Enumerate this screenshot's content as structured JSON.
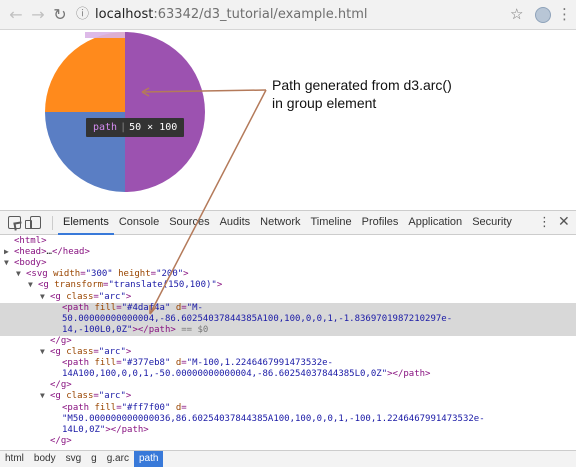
{
  "browser": {
    "url_host": "localhost",
    "url_rest": ":63342/d3_tutorial/example.html",
    "back_icon": "back-arrow-icon",
    "forward_icon": "forward-arrow-icon",
    "reload_icon": "reload-icon"
  },
  "page": {
    "annotation": "Path generated from d3.arc() in group element",
    "tooltip": {
      "tag": "path",
      "size": "50 × 100"
    },
    "pie_colors": [
      "#4daf4a",
      "#377eb8",
      "#ff7f00"
    ]
  },
  "chart_data": {
    "type": "pie",
    "values": [
      50,
      25,
      25
    ],
    "colors": [
      "#9c52b0",
      "#5a7ec4",
      "#ff8a1c"
    ],
    "highlight": "#d9b3e6"
  },
  "devtools": {
    "tabs": [
      "Elements",
      "Console",
      "Sources",
      "Audits",
      "Network",
      "Timeline",
      "Profiles",
      "Application",
      "Security"
    ],
    "active_tab": "Elements",
    "dom_lines": [
      {
        "indent": 0,
        "tw": "",
        "html": [
          [
            "t",
            "<html>"
          ]
        ]
      },
      {
        "indent": 0,
        "tw": "▶",
        "html": [
          [
            "t",
            "<head>"
          ],
          [
            "pl",
            "…"
          ],
          [
            "t",
            "</head>"
          ]
        ]
      },
      {
        "indent": 0,
        "tw": "▼",
        "html": [
          [
            "t",
            "<body>"
          ]
        ]
      },
      {
        "indent": 1,
        "tw": "▼",
        "html": [
          [
            "t",
            "<svg "
          ],
          [
            "an",
            "width"
          ],
          [
            "t",
            "="
          ],
          [
            "av",
            "\"300\""
          ],
          [
            "t",
            " "
          ],
          [
            "an",
            "height"
          ],
          [
            "t",
            "="
          ],
          [
            "av",
            "\"200\""
          ],
          [
            "t",
            ">"
          ]
        ]
      },
      {
        "indent": 2,
        "tw": "▼",
        "html": [
          [
            "t",
            "<g "
          ],
          [
            "an",
            "transform"
          ],
          [
            "t",
            "="
          ],
          [
            "av",
            "\"translate(150,100)\""
          ],
          [
            "t",
            ">"
          ]
        ]
      },
      {
        "indent": 3,
        "tw": "▼",
        "html": [
          [
            "t",
            "<g "
          ],
          [
            "an",
            "class"
          ],
          [
            "t",
            "="
          ],
          [
            "av",
            "\"arc\""
          ],
          [
            "t",
            ">"
          ]
        ]
      },
      {
        "indent": 4,
        "tw": "",
        "sel": true,
        "html": [
          [
            "t",
            "<path "
          ],
          [
            "an",
            "fill"
          ],
          [
            "t",
            "="
          ],
          [
            "av",
            "\"#4daf4a\""
          ],
          [
            "t",
            " "
          ],
          [
            "an",
            "d"
          ],
          [
            "t",
            "="
          ],
          [
            "av",
            "\"M-"
          ]
        ]
      },
      {
        "indent": 4,
        "tw": "",
        "sel": true,
        "html": [
          [
            "av",
            "50.00000000000004,-86.60254037844385A100,100,0,0,1,-1.8369701987210297e-"
          ]
        ]
      },
      {
        "indent": 4,
        "tw": "",
        "sel": true,
        "html": [
          [
            "av",
            "14,-100L0,0Z\""
          ],
          [
            "t",
            "></path>"
          ],
          [
            "eq",
            " == $0"
          ]
        ]
      },
      {
        "indent": 3,
        "tw": "",
        "html": [
          [
            "t",
            "</g>"
          ]
        ]
      },
      {
        "indent": 3,
        "tw": "▼",
        "html": [
          [
            "t",
            "<g "
          ],
          [
            "an",
            "class"
          ],
          [
            "t",
            "="
          ],
          [
            "av",
            "\"arc\""
          ],
          [
            "t",
            ">"
          ]
        ]
      },
      {
        "indent": 4,
        "tw": "",
        "html": [
          [
            "t",
            "<path "
          ],
          [
            "an",
            "fill"
          ],
          [
            "t",
            "="
          ],
          [
            "av",
            "\"#377eb8\""
          ],
          [
            "t",
            " "
          ],
          [
            "an",
            "d"
          ],
          [
            "t",
            "="
          ],
          [
            "av",
            "\"M-100,1.2246467991473532e-"
          ]
        ]
      },
      {
        "indent": 4,
        "tw": "",
        "html": [
          [
            "av",
            "14A100,100,0,0,1,-50.00000000000004,-86.60254037844385L0,0Z\""
          ],
          [
            "t",
            "></path>"
          ]
        ]
      },
      {
        "indent": 3,
        "tw": "",
        "html": [
          [
            "t",
            "</g>"
          ]
        ]
      },
      {
        "indent": 3,
        "tw": "▼",
        "html": [
          [
            "t",
            "<g "
          ],
          [
            "an",
            "class"
          ],
          [
            "t",
            "="
          ],
          [
            "av",
            "\"arc\""
          ],
          [
            "t",
            ">"
          ]
        ]
      },
      {
        "indent": 4,
        "tw": "",
        "html": [
          [
            "t",
            "<path "
          ],
          [
            "an",
            "fill"
          ],
          [
            "t",
            "="
          ],
          [
            "av",
            "\"#ff7f00\""
          ],
          [
            "t",
            " "
          ],
          [
            "an",
            "d"
          ],
          [
            "t",
            "="
          ]
        ]
      },
      {
        "indent": 4,
        "tw": "",
        "html": [
          [
            "av",
            "\"M50.000000000000036,86.60254037844385A100,100,0,0,1,-100,1.2246467991473532e-"
          ]
        ]
      },
      {
        "indent": 4,
        "tw": "",
        "html": [
          [
            "av",
            "14L0,0Z\""
          ],
          [
            "t",
            "></path>"
          ]
        ]
      },
      {
        "indent": 3,
        "tw": "",
        "html": [
          [
            "t",
            "</g>"
          ]
        ]
      }
    ],
    "breadcrumbs": [
      "html",
      "body",
      "svg",
      "g",
      "g.arc",
      "path"
    ],
    "active_crumb": "path"
  }
}
